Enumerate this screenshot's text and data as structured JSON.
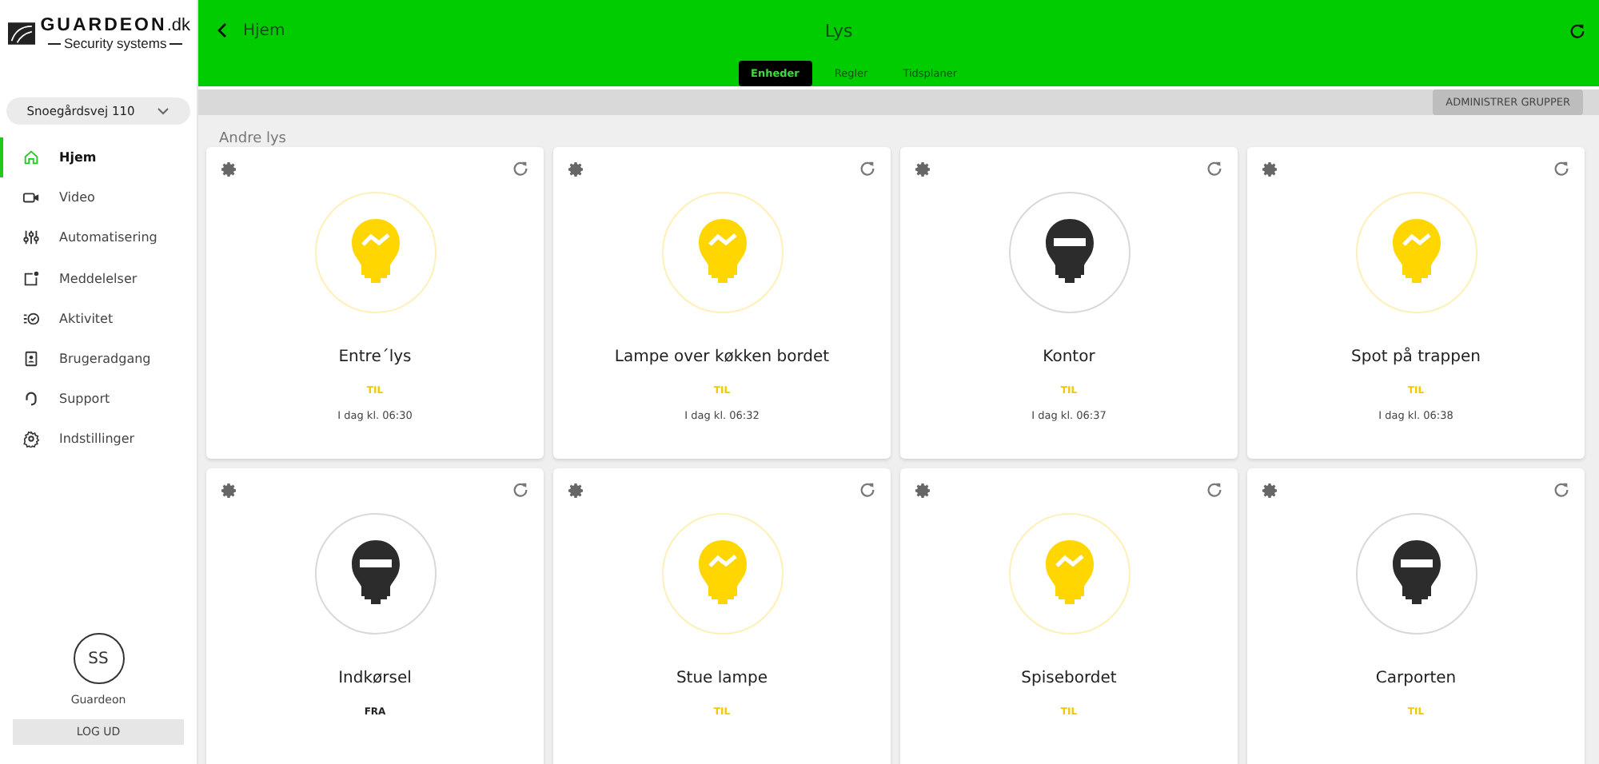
{
  "logo": {
    "name": "GUARDEON",
    "suffix": ".dk",
    "tagline": "Security systems"
  },
  "location": {
    "value": "Snoegårdsvej 110"
  },
  "nav": [
    {
      "label": "Hjem",
      "selected": true
    },
    {
      "label": "Video",
      "selected": false
    },
    {
      "label": "Automatisering",
      "selected": false
    },
    {
      "label": "Meddelelser",
      "selected": false
    },
    {
      "label": "Aktivitet",
      "selected": false
    },
    {
      "label": "Brugeradgang",
      "selected": false
    },
    {
      "label": "Support",
      "selected": false
    },
    {
      "label": "Indstillinger",
      "selected": false
    }
  ],
  "user": {
    "initials": "SS",
    "name": "Guardeon"
  },
  "logout": "LOG UD",
  "header": {
    "back": "Hjem",
    "title": "Lys"
  },
  "tabs": [
    {
      "label": "Enheder",
      "selected": true
    },
    {
      "label": "Regler",
      "selected": false
    },
    {
      "label": "Tidsplaner",
      "selected": false
    }
  ],
  "toolbar": {
    "button": "ADMINISTRER GRUPPER"
  },
  "section": "Andre lys",
  "lights": [
    {
      "name": "Entre´lys",
      "on": true,
      "status": "TIL",
      "status_on": true,
      "time": "I dag kl. 06:30"
    },
    {
      "name": "Lampe over køkken bordet",
      "on": true,
      "status": "TIL",
      "status_on": true,
      "time": "I dag kl. 06:32"
    },
    {
      "name": "Kontor",
      "on": false,
      "status": "TIL",
      "status_on": true,
      "time": "I dag kl. 06:37"
    },
    {
      "name": "Spot på trappen",
      "on": true,
      "status": "TIL",
      "status_on": true,
      "time": "I dag kl. 06:38"
    },
    {
      "name": "Indkørsel",
      "on": false,
      "status": "FRA",
      "status_on": false
    },
    {
      "name": "Stue lampe",
      "on": true,
      "status": "TIL",
      "status_on": true
    },
    {
      "name": "Spisebordet",
      "on": true,
      "status": "TIL",
      "status_on": true
    },
    {
      "name": "Carporten",
      "on": false,
      "status": "TIL",
      "status_on": true
    }
  ]
}
